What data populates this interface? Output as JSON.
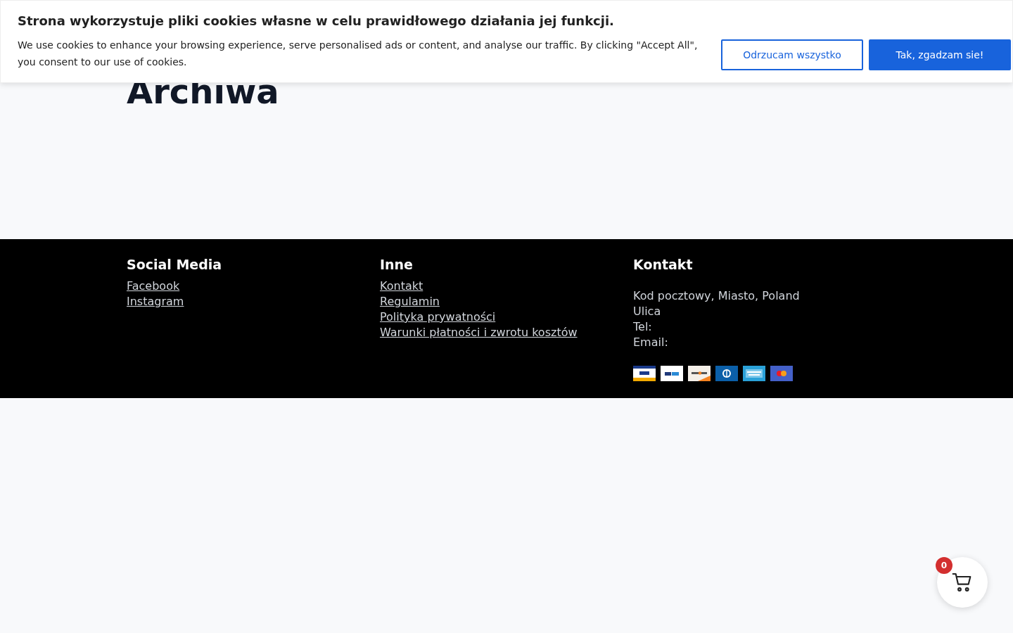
{
  "cookie_banner": {
    "title": "Strona wykorzystuje pliki cookies własne w celu prawidłowego działania jej funkcji.",
    "text": "We use cookies to enhance your browsing experience, serve personalised ads or content, and analyse our traffic. By clicking \"Accept All\", you consent to our use of cookies.",
    "buttons": [
      {
        "label": "Odrzucam wszystko",
        "kind": "outline"
      },
      {
        "label": "Tak, zgadzam sie!",
        "kind": "primary"
      }
    ]
  },
  "page": {
    "heading": "Archiwa"
  },
  "footer": {
    "columns": [
      {
        "title": "Social Media",
        "links": [
          "Facebook",
          "Instagram"
        ]
      },
      {
        "title": "Inne",
        "links": [
          "Kontakt",
          "Regulamin",
          "Polityka prywatności",
          "Warunki płatności i zwrotu kosztów"
        ]
      },
      {
        "title": "Kontakt",
        "lines": [
          "Kod pocztowy, Miasto, Poland",
          "Ulica",
          "Tel:",
          "Email:"
        ],
        "payment_icons": [
          {
            "kind": "visa"
          },
          {
            "kind": "paypal"
          },
          {
            "kind": "discover"
          },
          {
            "kind": "diners"
          },
          {
            "kind": "amex"
          },
          {
            "kind": "mastercard"
          }
        ]
      }
    ]
  },
  "cart": {
    "count": "0"
  }
}
